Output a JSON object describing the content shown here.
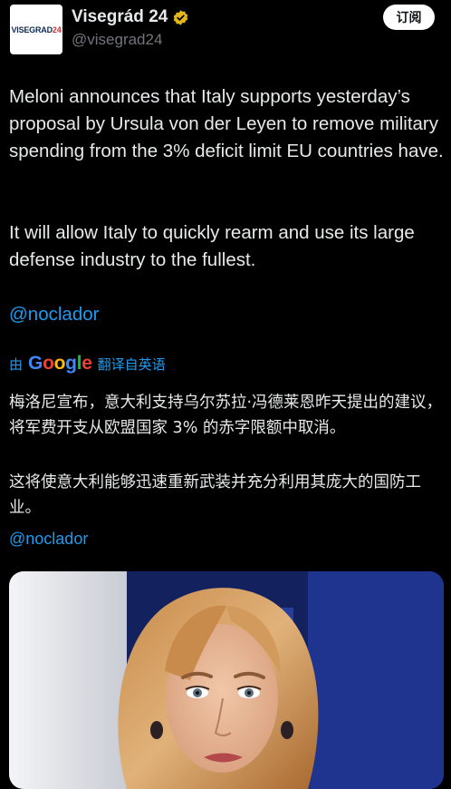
{
  "header": {
    "avatar_logo_text": "VISEGRAD",
    "avatar_logo_num": "24",
    "display_name": "Visegrád 24",
    "handle": "@visegrad24",
    "subscribe_label": "订阅"
  },
  "tweet": {
    "paragraph1": "Meloni announces that Italy supports yesterday’s proposal by Ursula von der Leyen to remove military spending from the 3% deficit limit EU countries have.",
    "paragraph2": "It will allow Italy to quickly rearm and use its large defense industry to the fullest.",
    "mention": "@noclador"
  },
  "translation": {
    "by_label": "由",
    "google_letters": [
      "G",
      "o",
      "o",
      "g",
      "l",
      "e"
    ],
    "translated_from": "翻译自英语",
    "paragraph1": "梅洛尼宣布，意大利支持乌尔苏拉·冯德莱恩昨天提出的建议，将军费开支从欧盟国家 3% 的赤字限额中取消。",
    "paragraph2": "这将使意大利能够迅速重新武装并充分利用其庞大的国防工业。",
    "mention": "@noclador"
  },
  "colors": {
    "background": "#000000",
    "text": "#e7e9ea",
    "secondary": "#71767b",
    "link": "#1d9bf0",
    "verified_gold": "#e2b719"
  }
}
